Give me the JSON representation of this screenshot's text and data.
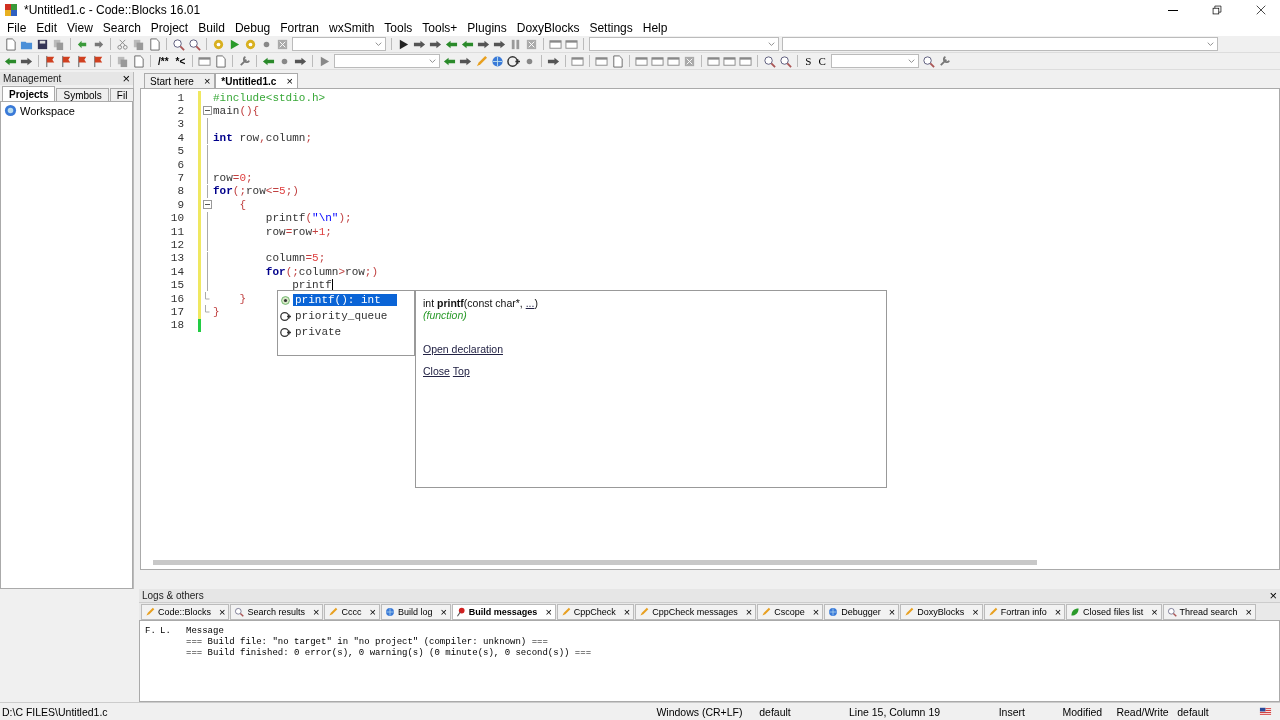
{
  "window": {
    "title": "*Untitled1.c - Code::Blocks 16.01"
  },
  "menu": [
    "File",
    "Edit",
    "View",
    "Search",
    "Project",
    "Build",
    "Debug",
    "Fortran",
    "wxSmith",
    "Tools",
    "Tools+",
    "Plugins",
    "DoxyBlocks",
    "Settings",
    "Help"
  ],
  "toolbar2": {
    "doc_buttons": [
      "/**",
      "*<"
    ],
    "letter_buttons": [
      "S",
      "C"
    ]
  },
  "management": {
    "title": "Management",
    "close": "×",
    "tabs": [
      {
        "label": "Projects",
        "selected": true
      },
      {
        "label": "Symbols",
        "selected": false
      },
      {
        "label": "Fil",
        "selected": false
      }
    ],
    "tree": [
      {
        "label": "Workspace"
      }
    ]
  },
  "editor_tabs": [
    {
      "label": "Start here",
      "selected": false,
      "close": "×"
    },
    {
      "label": "*Untitled1.c",
      "selected": true,
      "close": "×"
    }
  ],
  "code_lines": [
    {
      "number": "1",
      "saved": false,
      "tokens": [
        {
          "kind": "preproc",
          "text": "#include<stdio.h>"
        }
      ]
    },
    {
      "number": "2",
      "saved": false,
      "fold_start": true,
      "tokens": [
        {
          "kind": "plain",
          "text": "main"
        },
        {
          "kind": "op",
          "text": "(){"
        }
      ]
    },
    {
      "number": "3",
      "saved": false
    },
    {
      "number": "4",
      "saved": false,
      "tokens": [
        {
          "kind": "keyword",
          "text": "int"
        },
        {
          "kind": "plain",
          "text": " row"
        },
        {
          "kind": "op",
          "text": ","
        },
        {
          "kind": "plain",
          "text": "column"
        },
        {
          "kind": "op",
          "text": ";"
        }
      ]
    },
    {
      "number": "5",
      "saved": false
    },
    {
      "number": "6",
      "saved": false
    },
    {
      "number": "7",
      "saved": false,
      "tokens": [
        {
          "kind": "plain",
          "text": "row"
        },
        {
          "kind": "op",
          "text": "="
        },
        {
          "kind": "number",
          "text": "0"
        },
        {
          "kind": "op",
          "text": ";"
        }
      ]
    },
    {
      "number": "8",
      "saved": false,
      "tokens": [
        {
          "kind": "keyword",
          "text": "for"
        },
        {
          "kind": "op",
          "text": "(;"
        },
        {
          "kind": "plain",
          "text": "row"
        },
        {
          "kind": "op",
          "text": "<="
        },
        {
          "kind": "number",
          "text": "5"
        },
        {
          "kind": "op",
          "text": ";)"
        }
      ]
    },
    {
      "number": "9",
      "saved": false,
      "fold_start": true,
      "tokens": [
        {
          "kind": "op",
          "text": "    {"
        }
      ]
    },
    {
      "number": "10",
      "saved": false,
      "tokens": [
        {
          "kind": "plain",
          "text": "        printf"
        },
        {
          "kind": "op",
          "text": "("
        },
        {
          "kind": "string",
          "text": "\"\\n\""
        },
        {
          "kind": "op",
          "text": ");"
        }
      ]
    },
    {
      "number": "11",
      "saved": false,
      "tokens": [
        {
          "kind": "plain",
          "text": "        row"
        },
        {
          "kind": "op",
          "text": "="
        },
        {
          "kind": "plain",
          "text": "row"
        },
        {
          "kind": "op",
          "text": "+"
        },
        {
          "kind": "number",
          "text": "1"
        },
        {
          "kind": "op",
          "text": ";"
        }
      ]
    },
    {
      "number": "12",
      "saved": false
    },
    {
      "number": "13",
      "saved": false,
      "tokens": [
        {
          "kind": "plain",
          "text": "        column"
        },
        {
          "kind": "op",
          "text": "="
        },
        {
          "kind": "number",
          "text": "5"
        },
        {
          "kind": "op",
          "text": ";"
        }
      ]
    },
    {
      "number": "14",
      "saved": false,
      "tokens": [
        {
          "kind": "keyword",
          "text": "        for"
        },
        {
          "kind": "op",
          "text": "(;"
        },
        {
          "kind": "plain",
          "text": "column"
        },
        {
          "kind": "op",
          "text": ">"
        },
        {
          "kind": "plain",
          "text": "row"
        },
        {
          "kind": "op",
          "text": ";)"
        }
      ]
    },
    {
      "number": "15",
      "saved": false,
      "caret": true,
      "tokens": [
        {
          "kind": "plain",
          "text": "            printf"
        }
      ]
    },
    {
      "number": "16",
      "saved": false,
      "fold_end": true,
      "tokens": [
        {
          "kind": "op",
          "text": "    }"
        }
      ]
    },
    {
      "number": "17",
      "saved": false,
      "fold_end": true,
      "tokens": [
        {
          "kind": "op",
          "text": "}"
        }
      ]
    },
    {
      "number": "18",
      "saved": true
    }
  ],
  "autocomplete": {
    "items": [
      {
        "label": "printf(): int",
        "kind": "function",
        "selected": true
      },
      {
        "label": "priority_queue",
        "kind": "class",
        "selected": false
      },
      {
        "label": "private",
        "kind": "class",
        "selected": false
      }
    ],
    "info": {
      "signature": "int **printf**(const char*, ",
      "ellipsis": "...",
      "close_paren": ")",
      "category": "(function)",
      "open_link": "Open declaration",
      "close_link": "Close",
      "top_link": "Top"
    }
  },
  "logs": {
    "title": "Logs & others",
    "close": "×",
    "tabs": [
      {
        "label": "Code::Blocks",
        "kind": "note",
        "selected": false
      },
      {
        "label": "Search results",
        "kind": "search",
        "selected": false
      },
      {
        "label": "Cccc",
        "kind": "note",
        "selected": false
      },
      {
        "label": "Build log",
        "kind": "globe",
        "selected": false
      },
      {
        "label": "Build messages",
        "kind": "pin",
        "selected": true
      },
      {
        "label": "CppCheck",
        "kind": "note",
        "selected": false
      },
      {
        "label": "CppCheck messages",
        "kind": "note",
        "selected": false
      },
      {
        "label": "Cscope",
        "kind": "note",
        "selected": false
      },
      {
        "label": "Debugger",
        "kind": "globe",
        "selected": false
      },
      {
        "label": "DoxyBlocks",
        "kind": "note",
        "selected": false
      },
      {
        "label": "Fortran info",
        "kind": "note",
        "selected": false
      },
      {
        "label": "Closed files list",
        "kind": "leaf",
        "selected": false
      },
      {
        "label": "Thread search",
        "kind": "search",
        "selected": false
      }
    ],
    "tab_close": "×",
    "columns": [
      "F.",
      "L.",
      "Message"
    ],
    "rows": [
      {
        "message": "=== Build file: \"no target\" in \"no project\" (compiler: unknown) ==="
      },
      {
        "message": "=== Build finished: 0 error(s), 0 warning(s) (0 minute(s), 0 second(s)) ==="
      }
    ]
  },
  "status_bar": [
    "D:\\C FILES\\Untitled1.c",
    "Windows (CR+LF)",
    "default",
    "Line 15, Column 19",
    "Insert",
    "Modified",
    "Read/Write",
    "default"
  ]
}
